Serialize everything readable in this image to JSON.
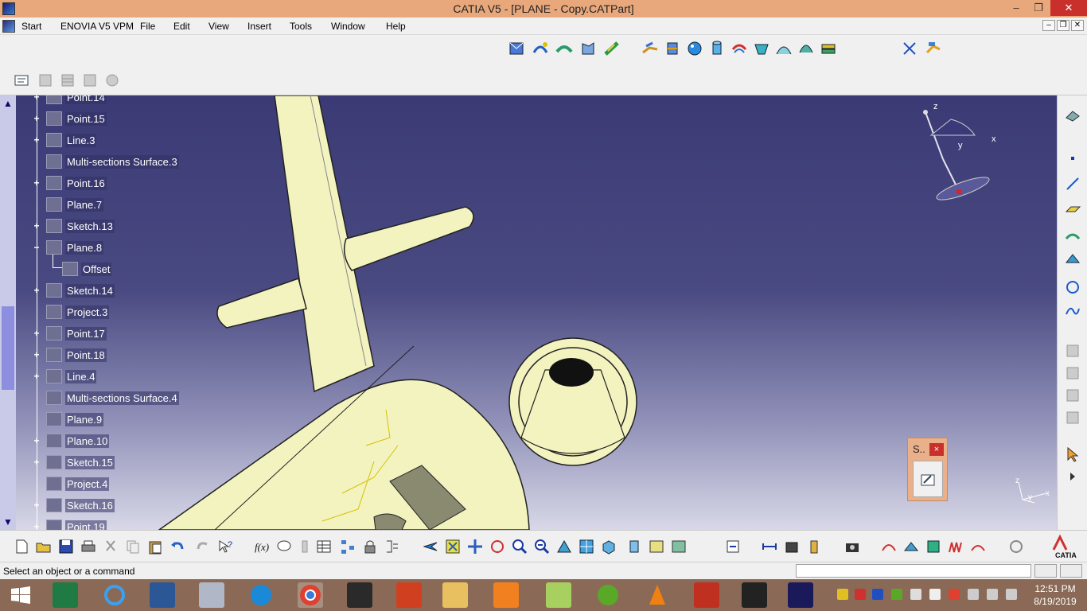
{
  "window": {
    "title": "CATIA V5 - [PLANE - Copy.CATPart]",
    "minimize": "–",
    "restore": "❐",
    "close": "✕"
  },
  "menu": {
    "items": [
      "Start",
      "ENOVIA V5 VPM",
      "File",
      "Edit",
      "View",
      "Insert",
      "Tools",
      "Window",
      "Help"
    ],
    "doc_minimize": "–",
    "doc_restore": "❐",
    "doc_close": "✕"
  },
  "tree": {
    "nodes": [
      {
        "label": "Point.14",
        "icon": "point-icon",
        "expander": "+"
      },
      {
        "label": "Point.15",
        "icon": "point-icon",
        "expander": "+"
      },
      {
        "label": "Line.3",
        "icon": "line-icon",
        "expander": "+"
      },
      {
        "label": "Multi-sections Surface.3",
        "icon": "multisection-surface-icon",
        "expander": ""
      },
      {
        "label": "Point.16",
        "icon": "point-icon",
        "expander": "+"
      },
      {
        "label": "Plane.7",
        "icon": "plane-icon",
        "expander": ""
      },
      {
        "label": "Sketch.13",
        "icon": "sketch-icon",
        "expander": "+"
      },
      {
        "label": "Plane.8",
        "icon": "plane-icon",
        "expander": "−"
      },
      {
        "label": "Offset",
        "icon": "offset-parameter-icon",
        "expander": "",
        "child": true
      },
      {
        "label": "Sketch.14",
        "icon": "sketch-icon",
        "expander": "+"
      },
      {
        "label": "Project.3",
        "icon": "project-icon",
        "expander": ""
      },
      {
        "label": "Point.17",
        "icon": "point-icon",
        "expander": "+"
      },
      {
        "label": "Point.18",
        "icon": "point-icon",
        "expander": "+"
      },
      {
        "label": "Line.4",
        "icon": "line-icon",
        "expander": "+"
      },
      {
        "label": "Multi-sections Surface.4",
        "icon": "multisection-surface-icon",
        "expander": ""
      },
      {
        "label": "Plane.9",
        "icon": "plane-icon",
        "expander": ""
      },
      {
        "label": "Plane.10",
        "icon": "plane-icon",
        "expander": "+"
      },
      {
        "label": "Sketch.15",
        "icon": "sketch-icon",
        "expander": "+"
      },
      {
        "label": "Project.4",
        "icon": "project-icon",
        "expander": ""
      },
      {
        "label": "Sketch.16",
        "icon": "sketch-icon",
        "expander": "+"
      },
      {
        "label": "Point.19",
        "icon": "point-icon",
        "expander": "+"
      }
    ]
  },
  "compass": {
    "z": "z",
    "x": "x",
    "y": "y"
  },
  "axis_triad": {
    "z": "z",
    "x": "x",
    "y": "y"
  },
  "mini_window": {
    "title": "S..",
    "close": "×"
  },
  "status": {
    "message": "Select an object or a command",
    "command_value": ""
  },
  "taskbar": {
    "time": "12:51 PM",
    "date": "8/19/2019"
  },
  "colors": {
    "viewport_top": "#3b3a75",
    "viewport_bottom": "#d8d8e8",
    "model": "#f5f5c8",
    "titlebar": "#e8a87c",
    "taskbar": "#8a6a56"
  }
}
